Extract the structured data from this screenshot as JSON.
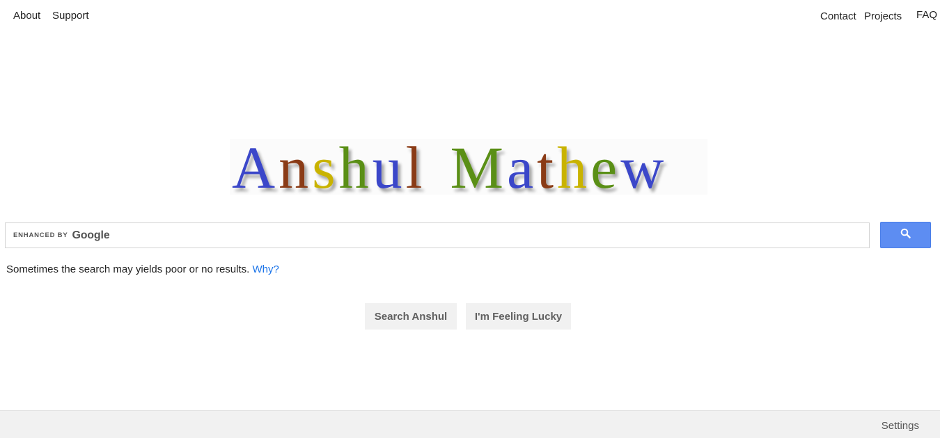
{
  "nav": {
    "about": "About",
    "support": "Support",
    "contact": "Contact",
    "projects": "Projects",
    "faq": "FAQ"
  },
  "logo": {
    "text": "Anshul Mathew",
    "letters": [
      "A",
      "n",
      "s",
      "h",
      "u",
      "l",
      "M",
      "a",
      "t",
      "h",
      "e",
      "w"
    ],
    "letter_colors": [
      "#3b47c9",
      "#8a3a12",
      "#c9b300",
      "#5a8f12",
      "#3b47c9",
      "#8a3a12",
      "#5a8f12",
      "#3b47c9",
      "#8a3a12",
      "#c9b300",
      "#5a8f12",
      "#3b47c9"
    ]
  },
  "search": {
    "placeholder": "",
    "value": "",
    "enhanced_label": "enhanced by",
    "google_label": "Google",
    "button_icon": "search-icon",
    "accent_color": "#5d8df2"
  },
  "notice": {
    "text": "Sometimes the search may yields poor or no results.",
    "link": "Why?"
  },
  "actions": {
    "search": "Search Anshul",
    "lucky": "I'm Feeling Lucky"
  },
  "footer": {
    "settings": "Settings"
  }
}
